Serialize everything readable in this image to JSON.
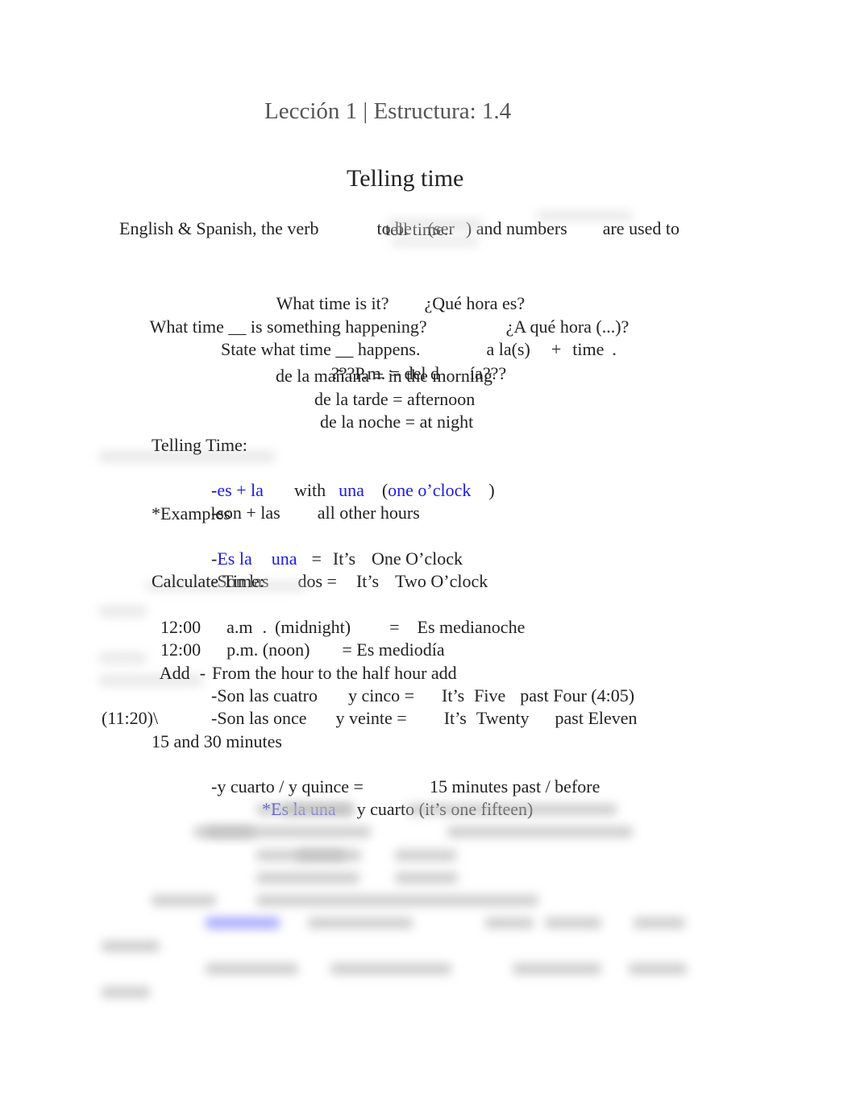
{
  "header": {
    "title": "Lección 1 | Estructura: 1.4"
  },
  "section_title": "Telling time",
  "intro": {
    "part1": "English & Spanish, the verb",
    "part2": "to be",
    "part3": "(ser",
    "part4": ")",
    "part5": "and numbers",
    "part6": "are used to",
    "part7": "tell time."
  },
  "questions": {
    "q1_en": "What time is it?",
    "q1_es": "¿Qué hora es?",
    "q2_en": "What time __ is something happening?",
    "q2_es": "¿A qué hora (...)?",
    "q3_en": "State what time __ happens.",
    "q3_es_a": "a la(s)",
    "q3_es_b": "+",
    "q3_es_c": "time",
    "q3_es_d": "."
  },
  "periods": {
    "pm_a": "???P.m. = del d",
    "pm_b": "ía???",
    "morning": "de la mañana = in the morning",
    "afternoon": "de la tarde = afternoon",
    "night": "de la noche = at night"
  },
  "telling": {
    "heading": "Telling Time:",
    "r1_dash": "-",
    "r1_a": "es + la",
    "r1_b": "with",
    "r1_c": "una",
    "r1_d": "(",
    "r1_e": "one o’clock",
    "r1_f": ")",
    "r2_a": "-son + las",
    "r2_b": "all other hours"
  },
  "examples": {
    "heading": "*Examples",
    "e1_dash": "-",
    "e1_a": "Es la",
    "e1_b": "una",
    "e1_c": "=",
    "e1_d": "It’s",
    "e1_e": "One O’clock",
    "e2_a": "-Son las",
    "e2_b": "dos =",
    "e2_c": "It’s",
    "e2_d": "Two O’clock"
  },
  "calculate": {
    "heading": "Calculate Time:",
    "m_a": "12:00",
    "m_b": "a.m",
    "m_c": ".",
    "m_d": "(midnight)",
    "m_e": "=",
    "m_f": "Es medianoche",
    "n_a": "12:00",
    "n_b": "p.m. (noon)",
    "n_c": "= Es mediodía",
    "add_a": "Add",
    "add_b": "-",
    "add_c": "From the hour to the half hour add",
    "ex1_a": "-Son las cuatro",
    "ex1_b": "y cinco =",
    "ex1_c": "It’s",
    "ex1_d": "Five",
    "ex1_e": "past Four (4:05)",
    "ex2_a": "-Son las once",
    "ex2_b": "y veinte =",
    "ex2_c": "It’s",
    "ex2_d": "Twenty",
    "ex2_e": "past Eleven",
    "ex2_f": "(11:20)\\"
  },
  "minutes": {
    "heading": "15 and 30 minutes",
    "r1_a": "-y cuarto / y quince =",
    "r1_b": "15 minutes past / before",
    "ex_a": "*Es la una",
    "ex_b": "y cuarto (it’s one fifteen)"
  },
  "colors": {
    "accent_blue": "#1a1ae6",
    "title_gray": "#555555",
    "text": "#222222"
  }
}
